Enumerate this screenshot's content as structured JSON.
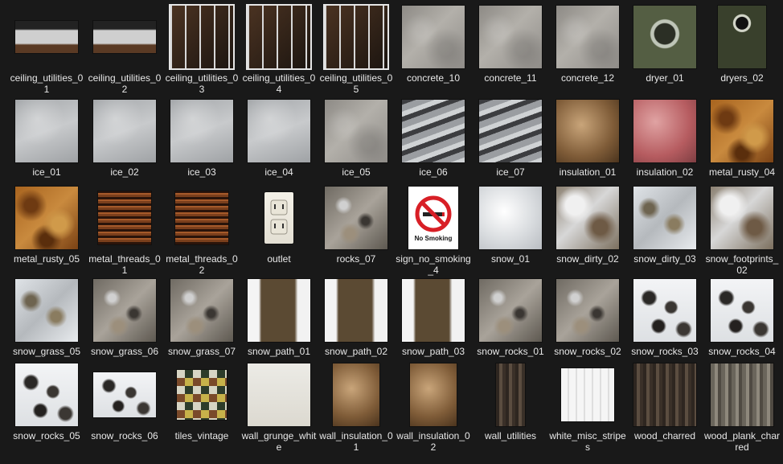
{
  "items": [
    {
      "name": "ceiling_utilities_01",
      "tex": "ceiling-strip",
      "w": 78,
      "h": 40
    },
    {
      "name": "ceiling_utilities_02",
      "tex": "ceiling-strip",
      "w": 78,
      "h": 40
    },
    {
      "name": "ceiling_utilities_03",
      "tex": "cage",
      "framed": true
    },
    {
      "name": "ceiling_utilities_04",
      "tex": "cage",
      "framed": true
    },
    {
      "name": "ceiling_utilities_05",
      "tex": "cage",
      "framed": true
    },
    {
      "name": "concrete_10",
      "tex": "concrete"
    },
    {
      "name": "concrete_11",
      "tex": "concrete"
    },
    {
      "name": "concrete_12",
      "tex": "concrete"
    },
    {
      "name": "dryer_01",
      "tex": "dryer"
    },
    {
      "name": "dryers_02",
      "tex": "dryer2",
      "w": 60
    },
    {
      "name": "ice_01",
      "tex": "ice"
    },
    {
      "name": "ice_02",
      "tex": "ice"
    },
    {
      "name": "ice_03",
      "tex": "ice"
    },
    {
      "name": "ice_04",
      "tex": "ice"
    },
    {
      "name": "ice_05",
      "tex": "concrete"
    },
    {
      "name": "ice_06",
      "tex": "ice-streak"
    },
    {
      "name": "ice_07",
      "tex": "ice-streak"
    },
    {
      "name": "insulation_01",
      "tex": "insul"
    },
    {
      "name": "insulation_02",
      "tex": "pink"
    },
    {
      "name": "metal_rusty_04",
      "tex": "rust"
    },
    {
      "name": "metal_rusty_05",
      "tex": "rust"
    },
    {
      "name": "metal_threads_01",
      "tex": "threads",
      "w": 66,
      "h": 66
    },
    {
      "name": "metal_threads_02",
      "tex": "threads",
      "w": 66,
      "h": 66
    },
    {
      "name": "outlet",
      "tex": "outlet",
      "w": 36,
      "h": 64
    },
    {
      "name": "rocks_07",
      "tex": "rock"
    },
    {
      "name": "sign_no_smoking_4",
      "tex": "sign",
      "w": 62
    },
    {
      "name": "snow_01",
      "tex": "snow"
    },
    {
      "name": "snow_dirty_02",
      "tex": "snowdirty"
    },
    {
      "name": "snow_dirty_03",
      "tex": "snowgrass"
    },
    {
      "name": "snow_footprints_02",
      "tex": "snowdirty"
    },
    {
      "name": "snow_grass_05",
      "tex": "snowgrass"
    },
    {
      "name": "snow_grass_06",
      "tex": "rock"
    },
    {
      "name": "snow_grass_07",
      "tex": "rock"
    },
    {
      "name": "snow_path_01",
      "tex": "path"
    },
    {
      "name": "snow_path_02",
      "tex": "path"
    },
    {
      "name": "snow_path_03",
      "tex": "path"
    },
    {
      "name": "snow_rocks_01",
      "tex": "rock"
    },
    {
      "name": "snow_rocks_02",
      "tex": "rock"
    },
    {
      "name": "snow_rocks_03",
      "tex": "snowrock"
    },
    {
      "name": "snow_rocks_04",
      "tex": "snowrock"
    },
    {
      "name": "snow_rocks_05",
      "tex": "snowrock"
    },
    {
      "name": "snow_rocks_06",
      "tex": "snowrock",
      "h": 56
    },
    {
      "name": "tiles_vintage",
      "tex": "tiles",
      "w": 62,
      "h": 62
    },
    {
      "name": "wall_grunge_white",
      "tex": "white"
    },
    {
      "name": "wall_insulation_01",
      "tex": "insul",
      "w": 58
    },
    {
      "name": "wall_insulation_02",
      "tex": "insul",
      "w": 58
    },
    {
      "name": "wall_utilities",
      "tex": "wood",
      "w": 36
    },
    {
      "name": "white_misc_stripes",
      "tex": "stripes",
      "w": 66,
      "h": 66
    },
    {
      "name": "wood_charred",
      "tex": "wood"
    },
    {
      "name": "wood_plank_charred",
      "tex": "woodplank"
    }
  ],
  "sign_text": "No Smoking"
}
